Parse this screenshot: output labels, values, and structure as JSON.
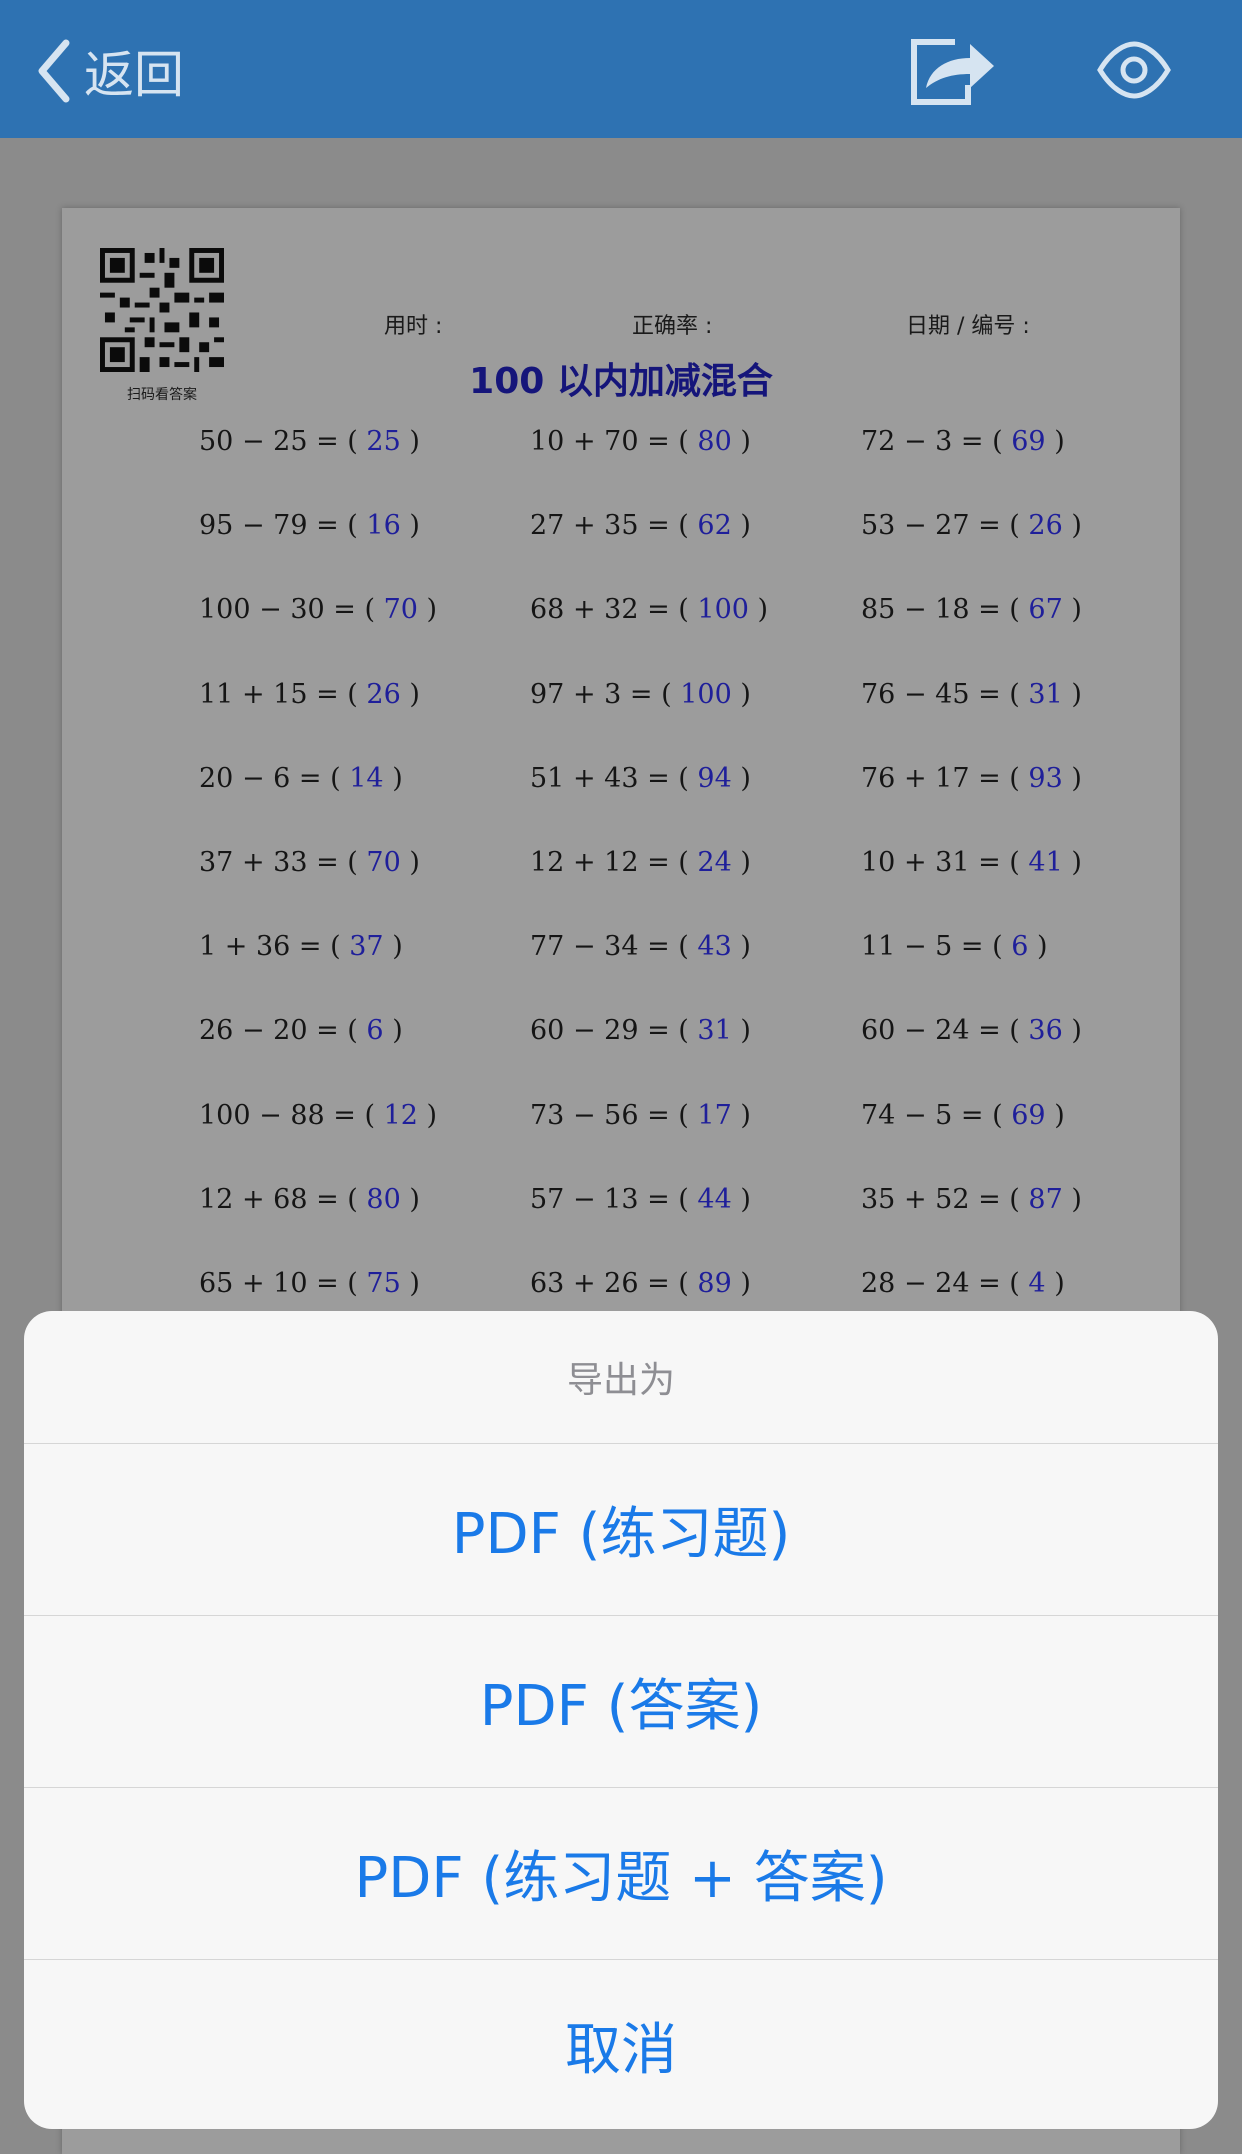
{
  "nav": {
    "back_label": "返回"
  },
  "worksheet": {
    "qr_caption": "扫码看答案",
    "time_label": "用时 :",
    "accuracy_label": "正确率 :",
    "date_label": "日期 / 编号 :",
    "title": "100 以内加减混合",
    "rows": [
      [
        {
          "q": "50 − 25 = (",
          "a": "25"
        },
        {
          "q": "10 + 70 = (",
          "a": "80"
        },
        {
          "q": "72 − 3 = (",
          "a": "69"
        }
      ],
      [
        {
          "q": "95 − 79 = (",
          "a": "16"
        },
        {
          "q": "27 + 35 = (",
          "a": "62"
        },
        {
          "q": "53 − 27 = (",
          "a": "26"
        }
      ],
      [
        {
          "q": "100 − 30 = (",
          "a": "70"
        },
        {
          "q": "68 + 32 = (",
          "a": "100"
        },
        {
          "q": "85 − 18 = (",
          "a": "67"
        }
      ],
      [
        {
          "q": "11 + 15 = (",
          "a": "26"
        },
        {
          "q": "97 + 3 = (",
          "a": "100"
        },
        {
          "q": "76 − 45 = (",
          "a": "31"
        }
      ],
      [
        {
          "q": "20 − 6 = (",
          "a": "14"
        },
        {
          "q": "51 + 43 = (",
          "a": "94"
        },
        {
          "q": "76 + 17 = (",
          "a": "93"
        }
      ],
      [
        {
          "q": "37 + 33 = (",
          "a": "70"
        },
        {
          "q": "12 + 12 = (",
          "a": "24"
        },
        {
          "q": "10 + 31 = (",
          "a": "41"
        }
      ],
      [
        {
          "q": "1 + 36 = (",
          "a": "37"
        },
        {
          "q": "77 − 34 = (",
          "a": "43"
        },
        {
          "q": "11 − 5 = (",
          "a": "6"
        }
      ],
      [
        {
          "q": "26 − 20 = (",
          "a": "6"
        },
        {
          "q": "60 − 29 = (",
          "a": "31"
        },
        {
          "q": "60 − 24 = (",
          "a": "36"
        }
      ],
      [
        {
          "q": "100 − 88 = (",
          "a": "12"
        },
        {
          "q": "73 − 56 = (",
          "a": "17"
        },
        {
          "q": "74 − 5 = (",
          "a": "69"
        }
      ],
      [
        {
          "q": "12 + 68 = (",
          "a": "80"
        },
        {
          "q": "57 − 13 = (",
          "a": "44"
        },
        {
          "q": "35 + 52 = (",
          "a": "87"
        }
      ],
      [
        {
          "q": "65 + 10 = (",
          "a": "75"
        },
        {
          "q": "63 + 26 = (",
          "a": "89"
        },
        {
          "q": "28 − 24 = (",
          "a": "4"
        }
      ]
    ]
  },
  "action_sheet": {
    "title": "导出为",
    "options": [
      "PDF (练习题)",
      "PDF (答案)",
      "PDF (练习题 + 答案)"
    ],
    "cancel": "取消"
  },
  "colors": {
    "navbar": "#2e72b2",
    "action_text": "#1a7ae8",
    "answer_text": "#1f1f9a"
  }
}
